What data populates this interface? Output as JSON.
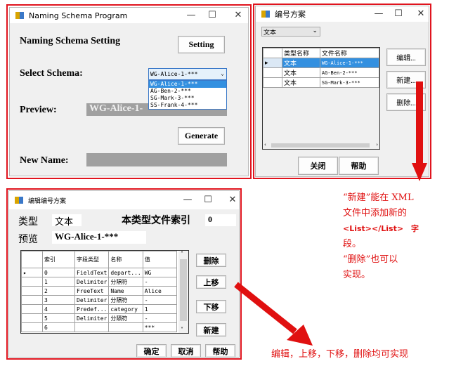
{
  "main_window": {
    "title": "Naming Schema Program",
    "heading": "Naming Schema Setting",
    "setting_btn": "Setting",
    "select_label": "Select Schema:",
    "selected": "WG-Alice-1-***",
    "options": [
      "WG-Alice-1-***",
      "AG-Ben-2-***",
      "SG-Mark-3-***",
      "SS-Frank-4-***"
    ],
    "preview_label": "Preview:",
    "preview_value": "WG-Alice-1-",
    "generate_btn": "Generate",
    "new_name_label": "New Name:",
    "new_name_value": ""
  },
  "schema_window": {
    "title": "编号方案",
    "type_select": "文本",
    "columns": [
      "类型名称",
      "文件名称"
    ],
    "rows": [
      [
        "文本",
        "WG-Alice-1-***"
      ],
      [
        "文本",
        "AG-Ben-2-***"
      ],
      [
        "文本",
        "SG-Mark-3-***"
      ]
    ],
    "edit_btn": "编辑...",
    "new_btn": "新建...",
    "delete_btn": "删除...",
    "close_btn": "关闭",
    "help_btn": "帮助"
  },
  "edit_window": {
    "title": "编辑编号方案",
    "type_label": "类型",
    "type_value": "文本",
    "index_label": "本类型文件索引",
    "index_value": "0",
    "preview_label": "预览",
    "preview_value": "WG-Alice-1-***",
    "columns": [
      "索引",
      "字段类型",
      "名称",
      "值"
    ],
    "rows": [
      [
        "0",
        "FieldText",
        "depart...",
        "WG"
      ],
      [
        "1",
        "Delimiter",
        "分隔符",
        "-"
      ],
      [
        "2",
        "FreeText",
        "Name",
        "Alice"
      ],
      [
        "3",
        "Delimiter",
        "分隔符",
        "-"
      ],
      [
        "4",
        "Predef...",
        "category",
        "1"
      ],
      [
        "5",
        "Delimiter",
        "分隔符",
        "-"
      ],
      [
        "6",
        "",
        "",
        "***"
      ]
    ],
    "delete_btn": "删除",
    "up_btn": "上移",
    "down_btn": "下移",
    "new_btn": "新建",
    "ok_btn": "确定",
    "cancel_btn": "取消",
    "help_btn": "帮助"
  },
  "annotations": {
    "right_lines": [
      "“新建”能在 XML",
      "文件中添加新的",
      "<List></List>　字",
      "段。",
      "“删除”也可以",
      "实现。"
    ],
    "bottom": "编辑，上移，下移，删除均可实现"
  },
  "colors": {
    "annotation": "#e01010",
    "selection": "#3390e0"
  }
}
